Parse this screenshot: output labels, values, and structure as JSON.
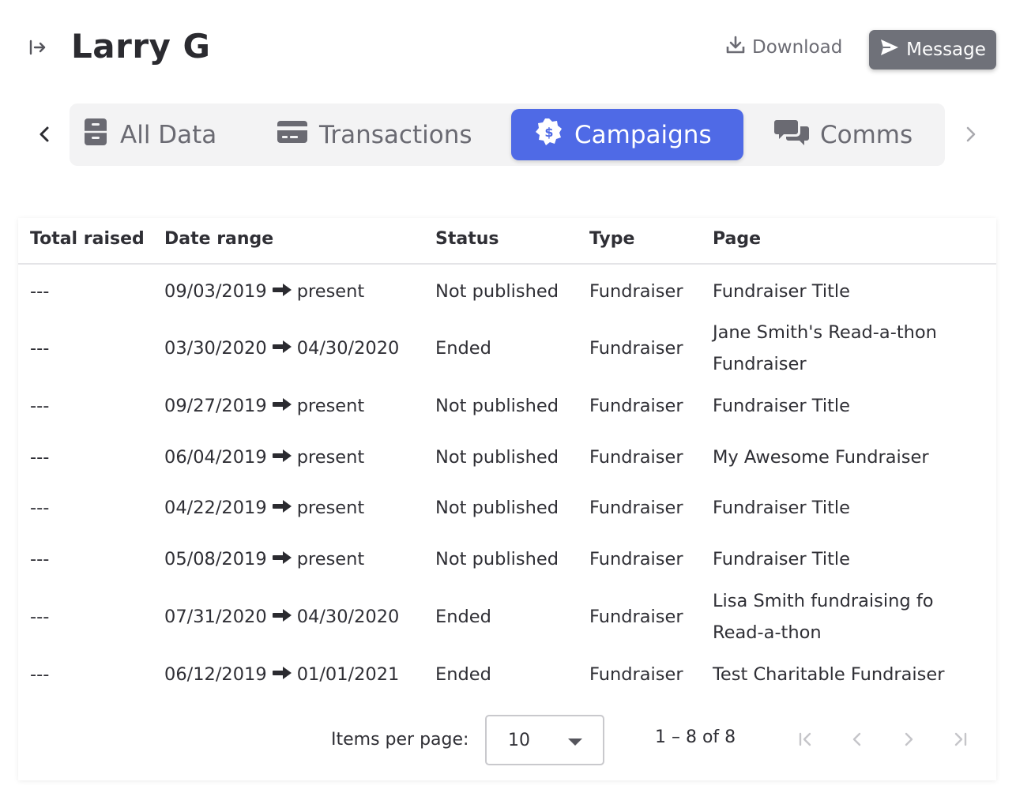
{
  "header": {
    "title": "Larry G",
    "download_label": "Download",
    "message_label": "Message"
  },
  "tabs": [
    {
      "label": "All Data",
      "icon": "file-cabinet-icon",
      "active": false
    },
    {
      "label": "Transactions",
      "icon": "credit-card-icon",
      "active": false
    },
    {
      "label": "Campaigns",
      "icon": "dollar-badge-icon",
      "active": true
    },
    {
      "label": "Comms",
      "icon": "chat-bubbles-icon",
      "active": false
    }
  ],
  "table": {
    "headers": [
      "Total raised",
      "Date range",
      "Status",
      "Type",
      "Page"
    ],
    "rows": [
      {
        "total": "---",
        "start": "09/03/2019",
        "end": "present",
        "status": "Not published",
        "type": "Fundraiser",
        "page": "Fundraiser Title"
      },
      {
        "total": "---",
        "start": "03/30/2020",
        "end": "04/30/2020",
        "status": "Ended",
        "type": "Fundraiser",
        "page": "Jane Smith's Read-a-thon Fundraiser"
      },
      {
        "total": "---",
        "start": "09/27/2019",
        "end": "present",
        "status": "Not published",
        "type": "Fundraiser",
        "page": "Fundraiser Title"
      },
      {
        "total": "---",
        "start": "06/04/2019",
        "end": "present",
        "status": "Not published",
        "type": "Fundraiser",
        "page": "My Awesome Fundraiser"
      },
      {
        "total": "---",
        "start": "04/22/2019",
        "end": "present",
        "status": "Not published",
        "type": "Fundraiser",
        "page": "Fundraiser Title"
      },
      {
        "total": "---",
        "start": "05/08/2019",
        "end": "present",
        "status": "Not published",
        "type": "Fundraiser",
        "page": "Fundraiser Title"
      },
      {
        "total": "---",
        "start": "07/31/2020",
        "end": "04/30/2020",
        "status": "Ended",
        "type": "Fundraiser",
        "page": "Lisa Smith fundraising fo Read-a-thon"
      },
      {
        "total": "---",
        "start": "06/12/2019",
        "end": "01/01/2021",
        "status": "Ended",
        "type": "Fundraiser",
        "page": "Test Charitable Fundraiser"
      }
    ]
  },
  "paginator": {
    "items_per_page_label": "Items per page:",
    "items_per_page_value": "10",
    "range_label": "1 – 8 of 8"
  },
  "colors": {
    "accent": "#4f6ae6",
    "message_button": "#6f7179",
    "tab_bar": "#f3f3f4"
  }
}
